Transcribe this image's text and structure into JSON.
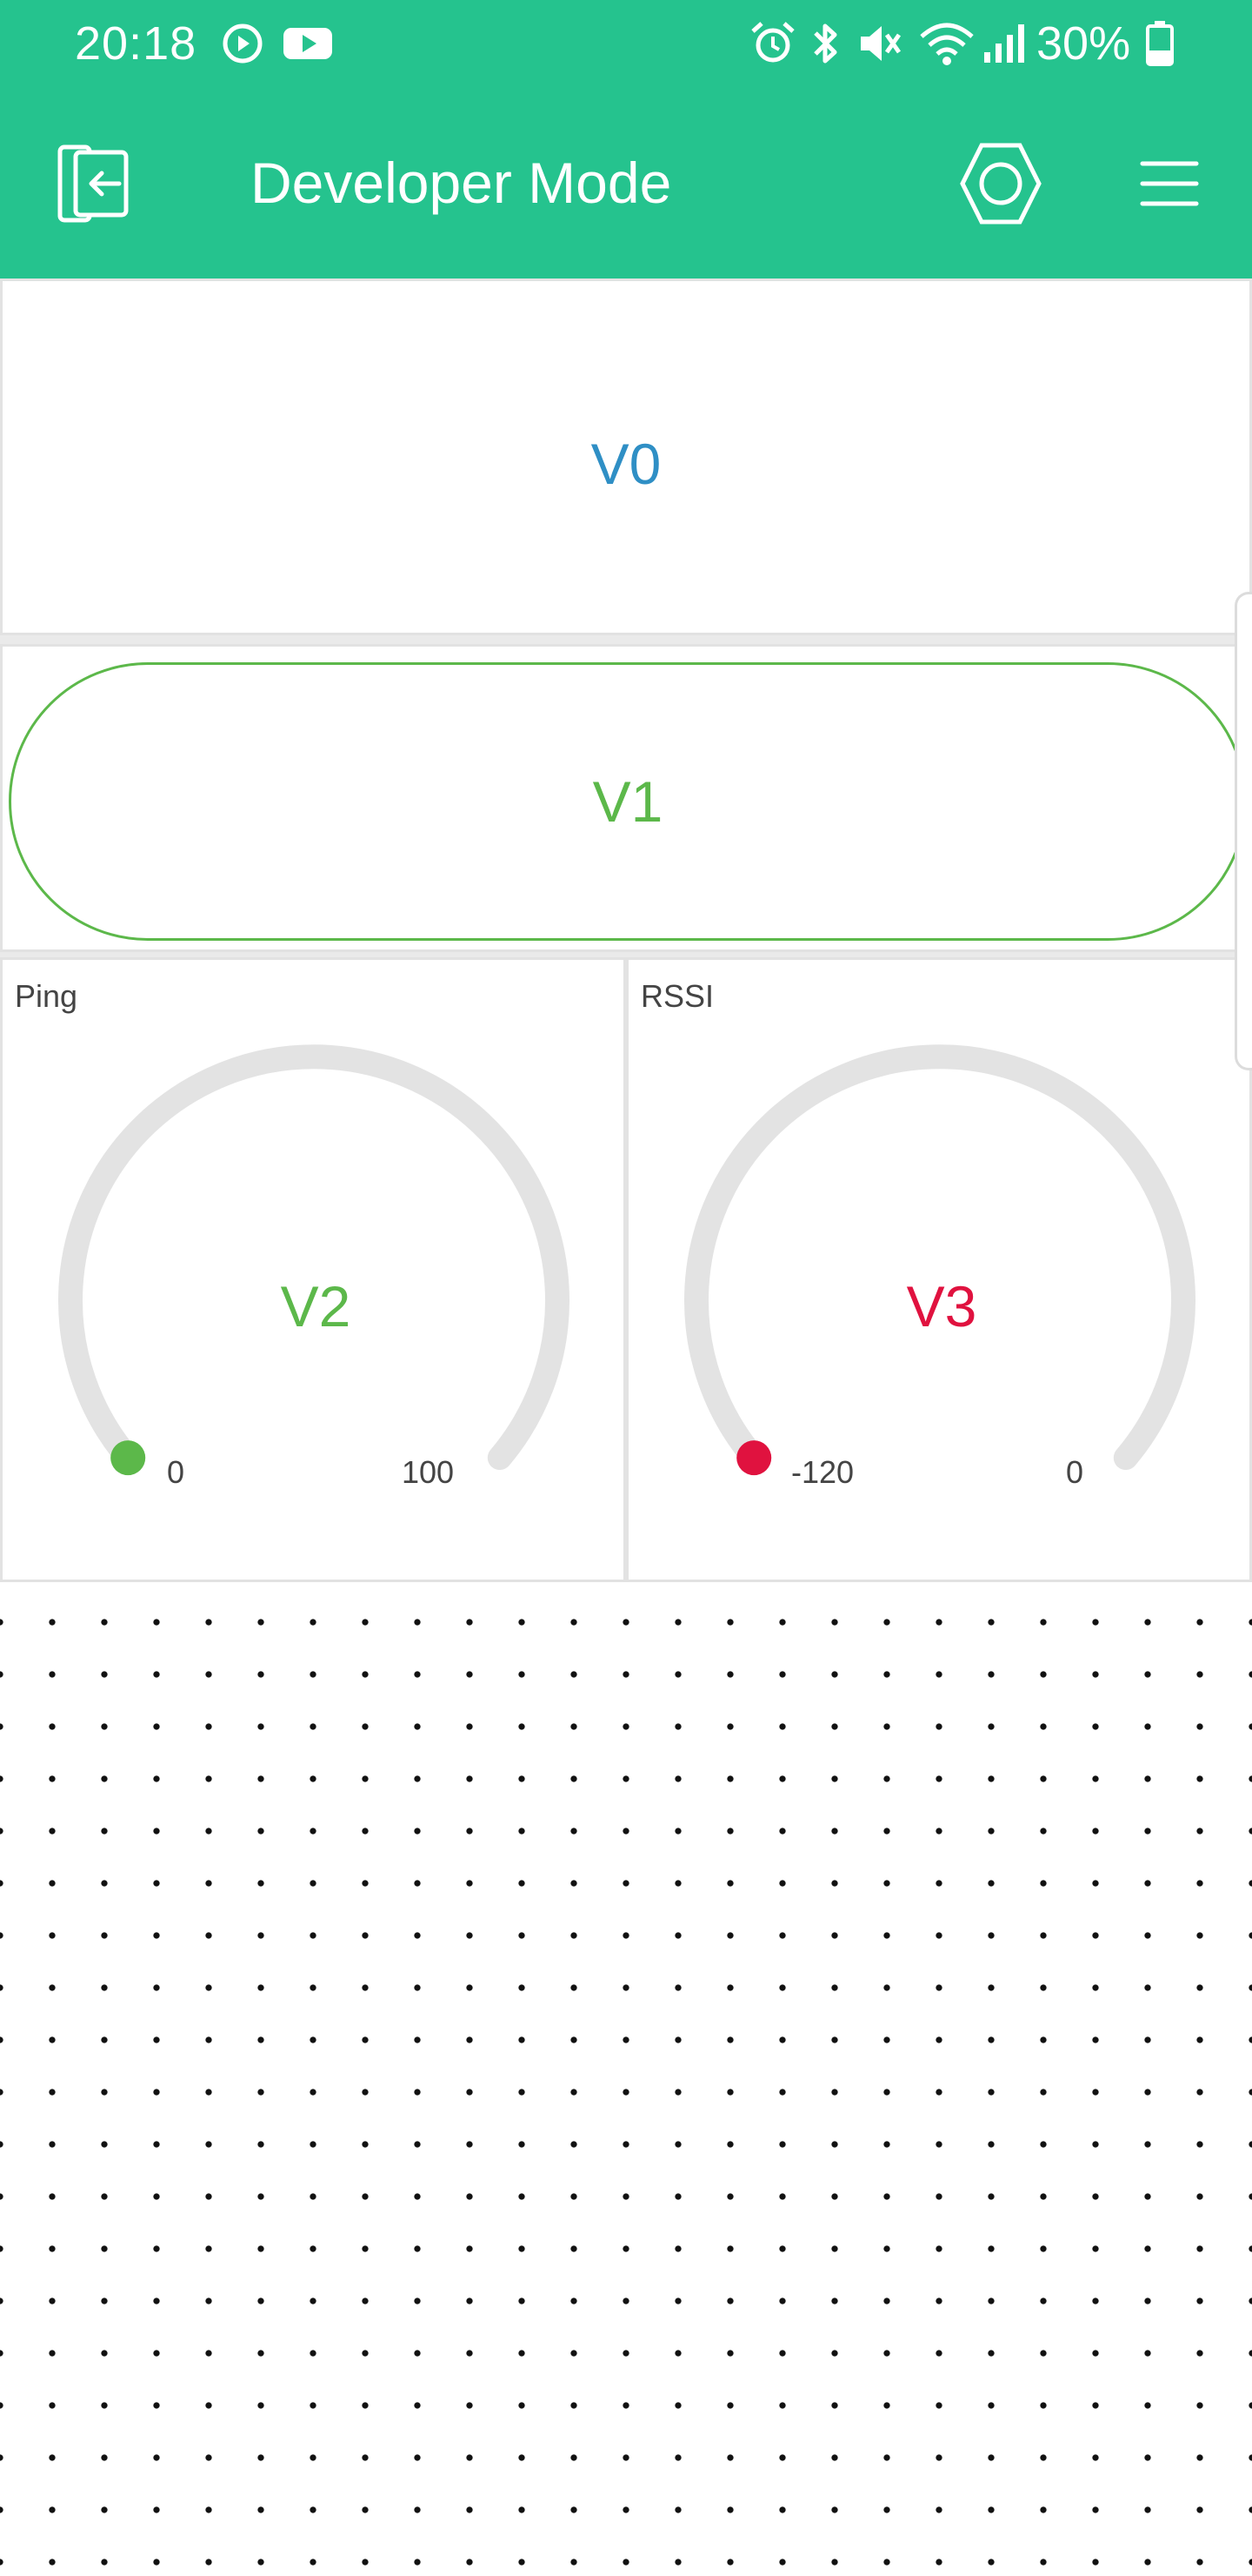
{
  "status_bar": {
    "time": "20:18",
    "battery_percent": "30%",
    "icons": [
      "media-icon",
      "youtube-icon",
      "alarm-icon",
      "bluetooth-icon",
      "mute-icon",
      "wifi-icon",
      "signal-icon",
      "battery-icon"
    ]
  },
  "app_bar": {
    "title": "Developer Mode",
    "icons": [
      "exit-icon",
      "hexagon-settings-icon",
      "menu-icon"
    ]
  },
  "colors": {
    "header": "#25c38e",
    "value_display": "#2f8fc5",
    "button": "#5cb84a",
    "gauge_ping": "#5cb84a",
    "gauge_rssi": "#e0123f",
    "gauge_track": "#e3e3e3"
  },
  "widgets": {
    "value_display": {
      "pin": "V0"
    },
    "button": {
      "pin": "V1"
    },
    "gauges": [
      {
        "title": "Ping",
        "pin": "V2",
        "min": "0",
        "max": "100",
        "level": 0
      },
      {
        "title": "RSSI",
        "pin": "V3",
        "min": "-120",
        "max": "0",
        "level": 0
      }
    ]
  }
}
